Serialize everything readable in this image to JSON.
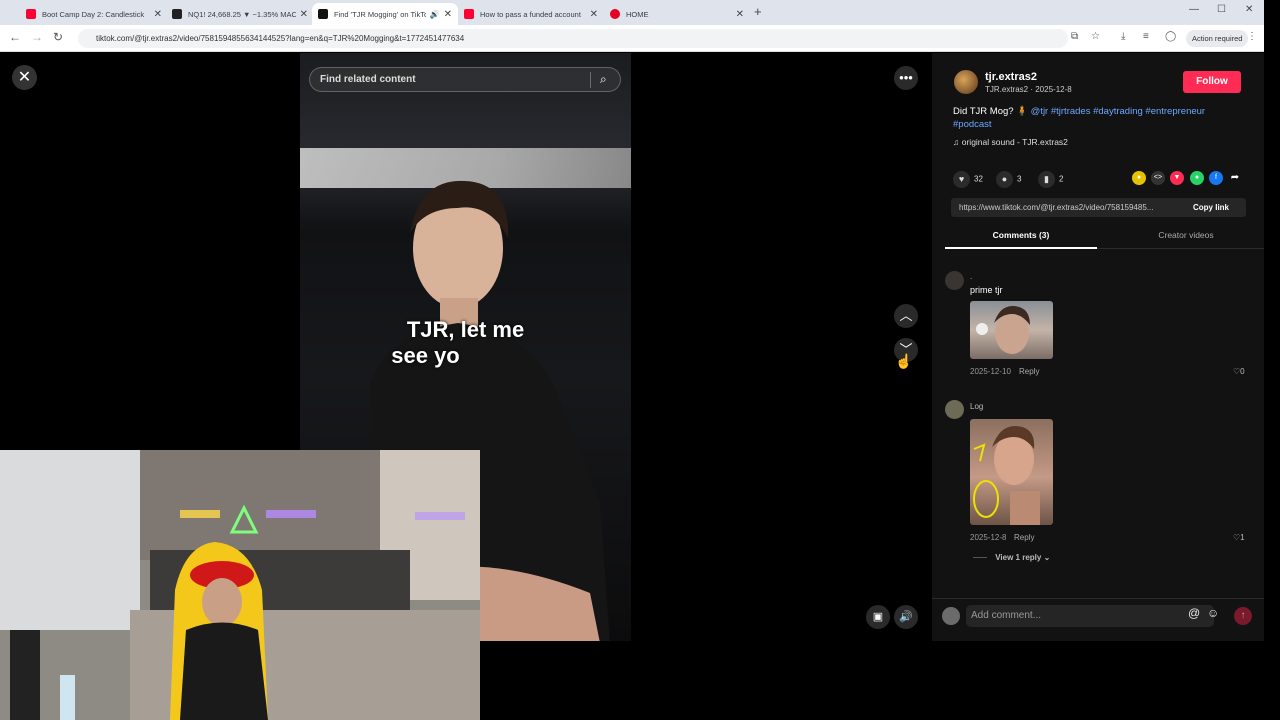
{
  "browser": {
    "tabs": [
      {
        "title": "Boot Camp Day 2: Candlestick",
        "color": "#ff0033"
      },
      {
        "title": "NQ1! 24,668.25 ▼ −1.35% MAC",
        "color": "#222222"
      },
      {
        "title": "Find 'TJR Mogging' on TikTo",
        "color": "#111111",
        "active": true
      },
      {
        "title": "How to pass a funded account",
        "color": "#ff0033"
      },
      {
        "title": "HOME",
        "color": "#e60023"
      }
    ],
    "new_tab": "+",
    "url": "tiktok.com/@tjr.extras2/video/7581594855634144525?lang=en&q=TJR%20Mogging&t=1772451477634",
    "action_required": "Action required"
  },
  "video": {
    "search_placeholder": "Find related content",
    "caption_line1": "TJR, let me",
    "caption_line2": "see yo"
  },
  "post": {
    "username": "tjr.extras2",
    "handle_date": "TJR.extras2 · 2025-12-8",
    "follow": "Follow",
    "description_text": "Did TJR Mog? 🧍",
    "tags": [
      "@tjr",
      "#tjrtrades",
      "#daytrading",
      "#entrepreneur",
      "#podcast"
    ],
    "sound": "original sound - TJR.extras2",
    "likes": "32",
    "comments": "3",
    "saves": "2",
    "link": "https://www.tiktok.com/@tjr.extras2/video/758159485...",
    "copy_link": "Copy link"
  },
  "panel_tabs": {
    "comments": "Comments (3)",
    "creator_videos": "Creator videos"
  },
  "comments": [
    {
      "name": ".",
      "text": "prime tjr",
      "date": "2025-12-10",
      "reply": "Reply",
      "likes": "0"
    },
    {
      "name": "Log",
      "text": "",
      "date": "2025-12-8",
      "reply": "Reply",
      "likes": "1",
      "view_replies": "View 1 reply"
    }
  ],
  "comment_bar": {
    "placeholder": "Add comment..."
  },
  "colors": {
    "accent": "#fe2c55",
    "link": "#6ea7ff"
  }
}
